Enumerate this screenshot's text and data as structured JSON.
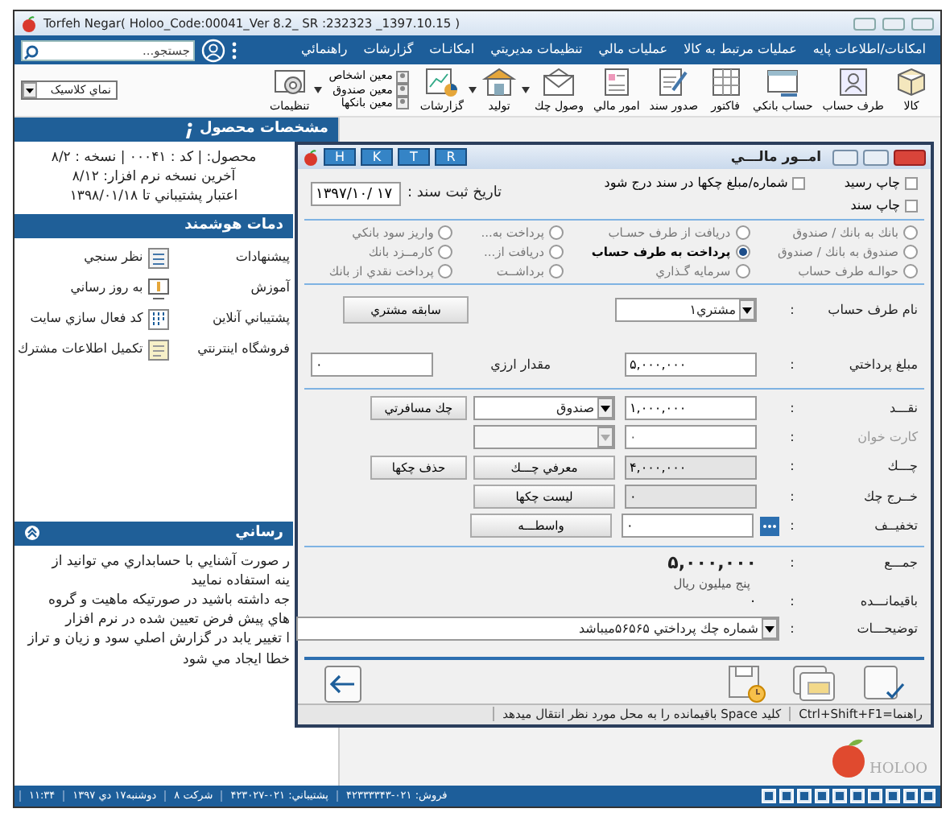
{
  "main_window": {
    "title": "Torfeh Negar( Holoo_Code:00041_Ver 8.2_ SR :232323 _1397.10.15 )"
  },
  "menu": [
    "امکانات/اطلاعات پايه",
    "عمليات مرتبط به کالا",
    "عمليات مالي",
    "تنظيمات مديريتي",
    "امکانـات",
    "گزارشات",
    "راهنمائي"
  ],
  "search": {
    "placeholder": "جستجو..."
  },
  "toolbar": {
    "items": [
      {
        "kind": "button",
        "label": "کالا",
        "dropdown": false
      },
      {
        "kind": "button",
        "label": "طرف حساب",
        "dropdown": false
      },
      {
        "kind": "button",
        "label": "حساب بانکي",
        "dropdown": false
      },
      {
        "kind": "button",
        "label": "فاکتور",
        "dropdown": false
      },
      {
        "kind": "button",
        "label": "صدور سند",
        "dropdown": false
      },
      {
        "kind": "button",
        "label": "امور مالي",
        "dropdown": false
      },
      {
        "kind": "button",
        "label": "وصول چك",
        "dropdown": true
      },
      {
        "kind": "button",
        "label": "توليد",
        "dropdown": true
      },
      {
        "kind": "button",
        "label": "گزارشات",
        "dropdown": false
      },
      {
        "kind": "links",
        "links": [
          "معين اشخاص",
          "معين صندوق",
          "معين بانکها"
        ],
        "dropdown": true
      },
      {
        "kind": "button",
        "label": "تنظيمات",
        "dropdown": false
      }
    ],
    "view_select": "نماي کلاسيک"
  },
  "product_panel": {
    "header": "مشخصات محصول",
    "lines": [
      "محصول:  | کد : ۰۰۰۴۱ | نسخه : ۸/۲",
      "آخرين نسخه نرم افزار: ۸/۱۲",
      "اعتبار پشتيباني تا ۱۳۹۸/۰۱/۱۸"
    ]
  },
  "services_panel": {
    "header": "دمات هوشمند",
    "items": [
      {
        "label": "پيشنهادات",
        "kind": "plain"
      },
      {
        "label": "نظر سنجي",
        "kind": "icon"
      },
      {
        "label": "آموزش",
        "kind": "plain"
      },
      {
        "label": "به روز رساني",
        "kind": "icon"
      },
      {
        "label": "پشتيباني آنلاين",
        "kind": "plain"
      },
      {
        "label": "کد فعال سازي سايت",
        "kind": "icon"
      },
      {
        "label": "فروشگاه اينترنتي",
        "kind": "plain"
      },
      {
        "label": "تکميل اطلاعات مشترك",
        "kind": "icon"
      }
    ]
  },
  "notice_panel": {
    "header": "رساني",
    "expanded": true,
    "lines": [
      "ر صورت آشنايي با حسابداري مي توانيد از",
      "ينه استفاده نماييد",
      "جه داشته باشيد در صورتيکه ماهيت و گروه",
      "هاي پيش فرض تعيين شده در نرم افزار",
      "ا تغيير يابد در گزارش اصلي سود و زيان و تراز",
      "خطا ايجاد مي شود"
    ]
  },
  "brand": "HOLOO",
  "status_bar": [
    "فروش: ۰۲۱-۴۲۳۳۳۳۴۳",
    "پشتيباني: ۰۲۱-۴۲۳۰۲۷",
    "شرکت ۸",
    "دوشنبه۱۷ دي ۱۳۹۷",
    "۱۱:۳۴"
  ],
  "dialog": {
    "title": "امــور مالـــي",
    "quick_buttons": [
      "R",
      "T",
      "K",
      "H"
    ],
    "options": [
      {
        "label": "چاپ رسيد",
        "checked": false
      },
      {
        "label": "شماره/مبلغ چکها در سند درج شود",
        "checked": false
      },
      {
        "label": "چاپ سند",
        "checked": false
      }
    ],
    "date": {
      "label": "تاريخ ثبت سند :",
      "value": "۱۳۹۷/۱۰/ ۱۷"
    },
    "operations": [
      {
        "label": "بانك به بانك / صندوق",
        "selected": false
      },
      {
        "label": "دريافت از طرف حسـاب",
        "selected": false
      },
      {
        "label": "پرداخت به...",
        "selected": false
      },
      {
        "label": "واريز سود بانکي",
        "selected": false
      },
      {
        "label": "صندوق به بانك / صندوق",
        "selected": false
      },
      {
        "label": "پرداخت به طرف حساب",
        "selected": true
      },
      {
        "label": "دريافت از...",
        "selected": false
      },
      {
        "label": "کارمــزد بانك",
        "selected": false
      },
      {
        "label": "حوالـه طرف حساب",
        "selected": false
      },
      {
        "label": "سرمايه گـذاري",
        "selected": false
      },
      {
        "label": "برداشــت",
        "selected": false
      },
      {
        "label": "پرداخت نقدي از بانك",
        "selected": false
      }
    ],
    "separator": ":",
    "account": {
      "label": "نام طرف حساب",
      "value": "مشتري۱",
      "button": "سابقه مشتري"
    },
    "payment": {
      "label": "مبلغ پرداختي",
      "value": "۵,۰۰۰,۰۰۰",
      "currency_label": "مقدار ارزي",
      "currency_value": "۰"
    },
    "lines": [
      {
        "label": "نقـــد",
        "disabled": false,
        "value": "۱,۰۰۰,۰۰۰",
        "readonly": false,
        "more": false,
        "kind": "combo",
        "combo": "صندوق",
        "button": "چك مسافرتي"
      },
      {
        "label": "کارت خوان",
        "disabled": true,
        "value": "۰",
        "readonly": false,
        "more": false,
        "kind": "combo"
      },
      {
        "label": "چـــك",
        "disabled": false,
        "value": "۴,۰۰۰,۰۰۰",
        "readonly": true,
        "more": false,
        "kind": "buttons",
        "buttons": [
          "معرفي چـــك",
          "حذف چکها"
        ]
      },
      {
        "label": "خــرج چك",
        "disabled": false,
        "value": "۰",
        "readonly": true,
        "more": false,
        "kind": "buttons",
        "buttons": [
          "ليست چکها"
        ]
      },
      {
        "label": "تخفيــف",
        "disabled": false,
        "value": "۰",
        "readonly": false,
        "more": true,
        "kind": "buttons",
        "buttons": [
          "واسطـــه"
        ]
      }
    ],
    "total": {
      "label": "جمـــع",
      "value": "۵,۰۰۰,۰۰۰",
      "words": "پنج ميليون  ريال"
    },
    "remainder": {
      "label": "باقيمانـــده",
      "value": "۰"
    },
    "description": {
      "label": "توضيحـــات",
      "value": "شماره چك پرداختي ۵۶۵۶۵ميباشد"
    },
    "hints": [
      "راهنما=Ctrl+Shift+F1",
      "کليد Space باقيمانده را به محل مورد نظر انتقال ميدهد"
    ]
  }
}
